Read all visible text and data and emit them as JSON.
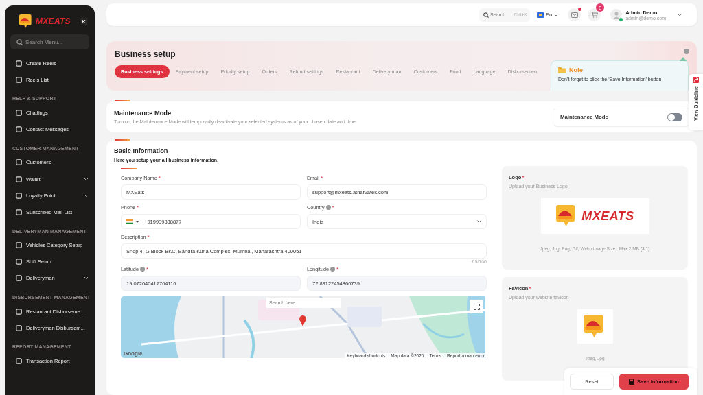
{
  "sidebar": {
    "brand": "MXEATS",
    "collapse_key": "K",
    "search": {
      "placeholder": "Search Menu..."
    },
    "sections": [
      {
        "items": [
          {
            "label": "Create Reels",
            "expandable": false
          },
          {
            "label": "Reels List",
            "expandable": false
          }
        ]
      },
      {
        "title": "HELP & SUPPORT",
        "items": [
          {
            "label": "Chattings",
            "expandable": false
          },
          {
            "label": "Contact Messages",
            "expandable": false
          }
        ]
      },
      {
        "title": "CUSTOMER MANAGEMENT",
        "items": [
          {
            "label": "Customers",
            "expandable": false
          },
          {
            "label": "Wallet",
            "expandable": true
          },
          {
            "label": "Loyalty Point",
            "expandable": true
          },
          {
            "label": "Subscribed Mail List",
            "expandable": false
          }
        ]
      },
      {
        "title": "DELIVERYMAN MANAGEMENT",
        "items": [
          {
            "label": "Vehicles Category Setup",
            "expandable": false
          },
          {
            "label": "Shift Setup",
            "expandable": false
          },
          {
            "label": "Deliveryman",
            "expandable": true
          }
        ]
      },
      {
        "title": "DISBURSEMENT MANAGEMENT",
        "items": [
          {
            "label": "Restaurant Disburseme...",
            "expandable": false
          },
          {
            "label": "Deliveryman Disbursem...",
            "expandable": false
          }
        ]
      },
      {
        "title": "REPORT MANAGEMENT",
        "items": [
          {
            "label": "Transaction Report",
            "expandable": false
          }
        ]
      }
    ]
  },
  "header": {
    "search": {
      "placeholder": "Search",
      "shortcut": "Ctrl+K"
    },
    "language": "En",
    "messages_unread": true,
    "cart_count": "0",
    "user": {
      "name": "Admin Demo",
      "email": "admin@demo.com",
      "online": true
    }
  },
  "business_setup": {
    "title": "Business setup",
    "tabs": [
      {
        "label": "Business settings",
        "selected": true
      },
      {
        "label": "Payment setup",
        "selected": false
      },
      {
        "label": "Priority setup",
        "selected": false
      },
      {
        "label": "Orders",
        "selected": false
      },
      {
        "label": "Refund settings",
        "selected": false
      },
      {
        "label": "Restaurant",
        "selected": false
      },
      {
        "label": "Delivery man",
        "selected": false
      },
      {
        "label": "Customers",
        "selected": false
      },
      {
        "label": "Food",
        "selected": false
      },
      {
        "label": "Language",
        "selected": false
      },
      {
        "label": "Disbursemen",
        "selected": false
      }
    ]
  },
  "note": {
    "title": "Note",
    "text": "Don’t forget to click the ‘Save Information’ button"
  },
  "view_guideline": "View Guideline",
  "maintenance": {
    "title": "Maintenance Mode",
    "description": "Turn on the Maintenance Mode will temporarily deactivate your selected systems as of your chosen date and time.",
    "toggle_label": "Maintenance Mode",
    "on": false
  },
  "basic_information": {
    "title": "Basic Information",
    "subtitle": "Here you setup your all business information.",
    "fields": [
      {
        "kind": "text",
        "label": "Company Name",
        "required": true,
        "required_mark": "*",
        "info": false,
        "value": "MXEats"
      },
      {
        "kind": "text",
        "label": "Email",
        "required": true,
        "required_mark": "*",
        "info": false,
        "value": "support@mxeats.atharvatek.com"
      },
      {
        "kind": "phone",
        "label": "Phone",
        "required": true,
        "required_mark": "*",
        "info": false,
        "value": "+919999888877"
      },
      {
        "kind": "select",
        "label": "Country",
        "required": true,
        "required_mark": "*",
        "info": true,
        "value": "India"
      },
      {
        "kind": "textarea",
        "label": "Description",
        "required": true,
        "required_mark": "*",
        "info": false,
        "value": "Shop 4, G Block BKC, Bandra Kurla Complex, Mumbai, Maharashtra 400051",
        "counter": "69/100"
      },
      {
        "kind": "readonly",
        "label": "Latitude",
        "required": true,
        "required_mark": "*",
        "info": true,
        "value": "19.072040417704116"
      },
      {
        "kind": "readonly",
        "label": "Longitude",
        "required": true,
        "required_mark": "*",
        "info": true,
        "value": "72.88122454860739"
      }
    ],
    "map": {
      "kind": "picture",
      "search_placeholder": "Search here",
      "logo": "Google",
      "footer_links": [
        "Keyboard shortcuts",
        "Map data ©2026",
        "Terms",
        "Report a map error"
      ]
    },
    "logo": {
      "title": "Logo",
      "required_mark": "*",
      "hint": "Upload your Business Logo",
      "brand": "MXEATS",
      "format": "Jpeg, Jpg, Png, Gif, Webp image Size : Max 2 MB **(3:1)**"
    },
    "favicon": {
      "title": "Favicon",
      "required_mark": "*",
      "hint": "Upload your website favicon",
      "format": "Jpeg, Jpg"
    }
  },
  "actions": {
    "reset": "Reset",
    "save": "Save Information"
  }
}
